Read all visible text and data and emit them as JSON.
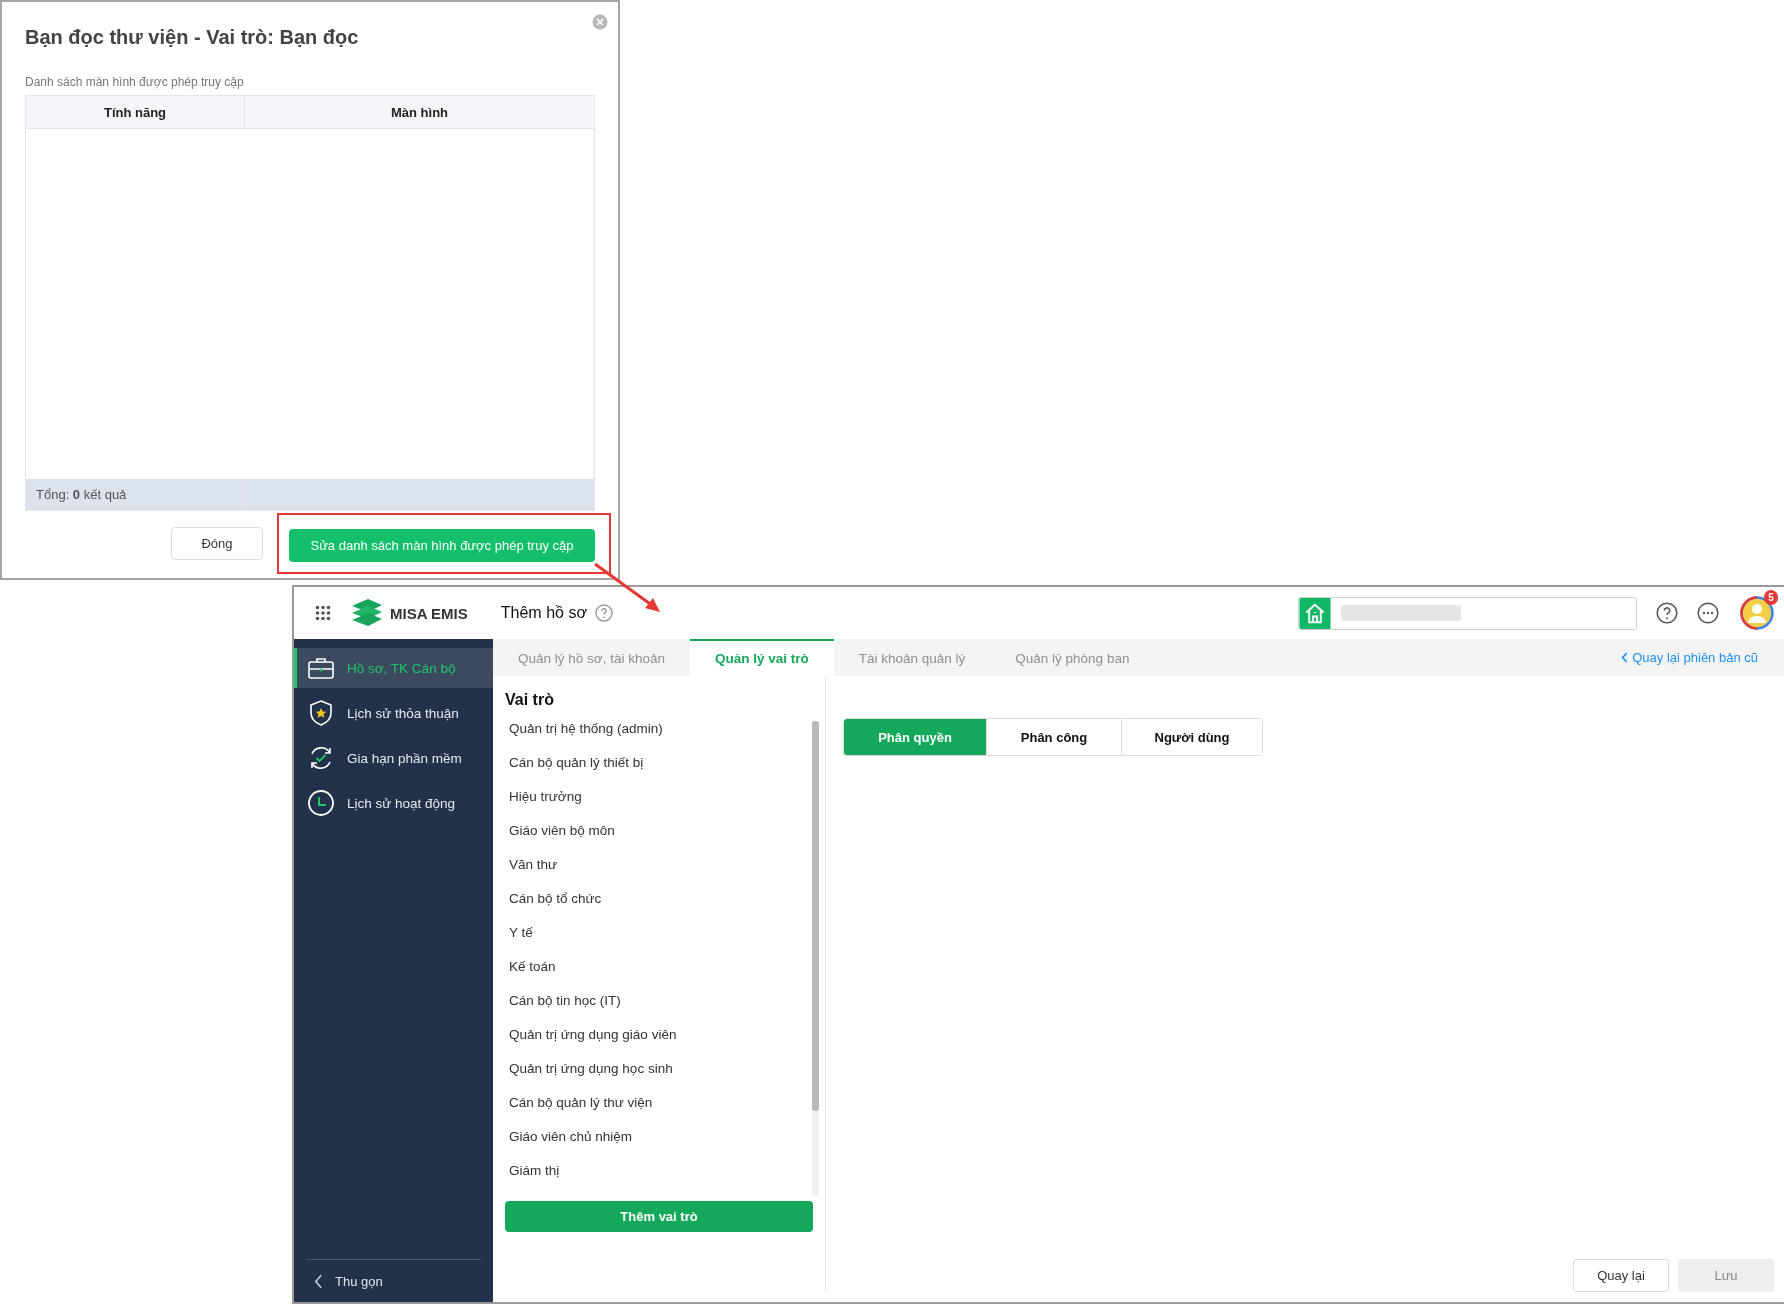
{
  "dialog": {
    "title": "Bạn đọc thư viện - Vai trò: Bạn đọc",
    "caption": "Danh sách màn hình được phép truy cập",
    "table": {
      "columns": [
        "Tính năng",
        "Màn hình"
      ],
      "footer": "Tổng: **0** kết quả"
    },
    "buttons": [
      {
        "label": "Đóng",
        "kind": "secondary",
        "highlighted": false
      },
      {
        "label": "Sửa danh sách màn hình được phép truy cập",
        "kind": "primary",
        "highlighted": true
      }
    ]
  },
  "app": {
    "brand": "MISA EMIS",
    "page_title": "Thêm hồ sơ",
    "notification_count": "5",
    "sidebar": {
      "items": [
        {
          "label": "Hồ sơ, TK Cán bộ",
          "selected": true
        },
        {
          "label": "Lịch sử thỏa thuận",
          "selected": false
        },
        {
          "label": "Gia hạn phần mềm",
          "selected": false
        },
        {
          "label": "Lịch sử hoạt động",
          "selected": false
        }
      ],
      "collapse": "Thu gọn"
    },
    "tabs": [
      {
        "label": "Quản lý hồ sơ, tài khoản",
        "selected": false
      },
      {
        "label": "Quản lý vai trò",
        "selected": true
      },
      {
        "label": "Tài khoản quản lý",
        "selected": false
      },
      {
        "label": "Quản lý phòng ban",
        "selected": false
      }
    ],
    "back_link": "Quay lại phiên bản cũ",
    "roles": {
      "heading": "Vai trò",
      "items": [
        "Quản trị hệ thống (admin)",
        "Cán bộ quản lý thiết bị",
        "Hiệu trưởng",
        "Giáo viên bộ môn",
        "Văn thư",
        "Cán bộ tổ chức",
        "Y tế",
        "Kế toán",
        "Cán bộ tin học (IT)",
        "Quản trị ứng dụng giáo viên",
        "Quản trị ứng dụng học sinh",
        "Cán bộ quản lý thư viện",
        "Giáo viên chủ nhiệm",
        "Giám thị"
      ],
      "add_button": "Thêm vai trò"
    },
    "segments": [
      {
        "label": "Phân quyền",
        "selected": true
      },
      {
        "label": "Phân công",
        "selected": false
      },
      {
        "label": "Người dùng",
        "selected": false
      }
    ],
    "footer_buttons": [
      {
        "label": "Quay lại",
        "disabled": false
      },
      {
        "label": "Lưu",
        "disabled": true
      }
    ]
  }
}
